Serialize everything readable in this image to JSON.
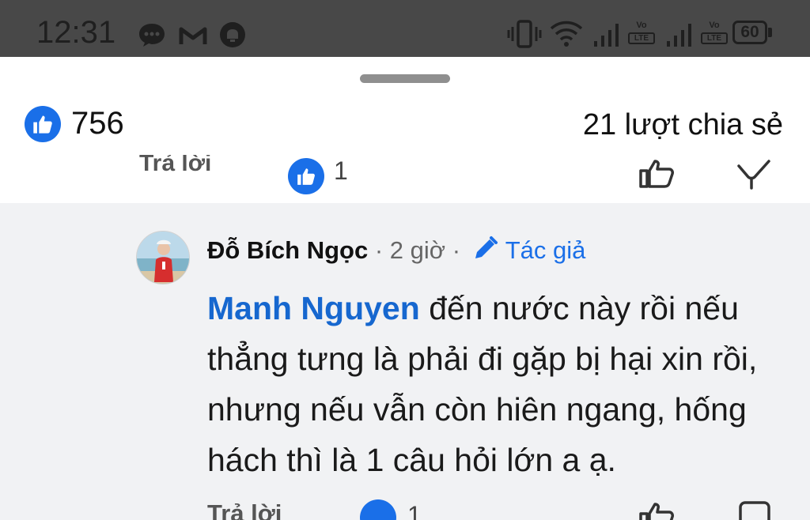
{
  "status_bar": {
    "time": "12:31",
    "battery": "60",
    "lte_label": "LTE",
    "volte_label": "Vo",
    "icons": [
      "chat-bubble-icon",
      "gmail-icon",
      "notification-app-icon",
      "vibrate-icon",
      "wifi-icon",
      "signal-icon",
      "volte-lte-icon",
      "signal-icon",
      "volte-lte-icon",
      "battery-icon"
    ]
  },
  "post_stats": {
    "likes": "756",
    "shares": "21 lượt chia sẻ"
  },
  "previous_comment_actions": {
    "reply_label": "Trả lời",
    "like_count": "1"
  },
  "comment": {
    "author": "Đỗ Bích Ngọc",
    "time": "· 2 giờ ·",
    "author_badge": "Tác giả",
    "mention": "Manh Nguyen",
    "text": " đến nước này rồi nếu thẳng tưng là phải đi gặp bị hại xin rồi, nhưng nếu vẫn còn hiên ngang, hống hách thì là 1 câu hỏi lớn a ạ.",
    "reply_label": "Trả lời",
    "like_count": "1"
  },
  "colors": {
    "status_bar_bg": "#484848",
    "accent_blue": "#1a6fe8",
    "mention_blue": "#1667cf",
    "comment_bg": "#f1f2f4"
  }
}
